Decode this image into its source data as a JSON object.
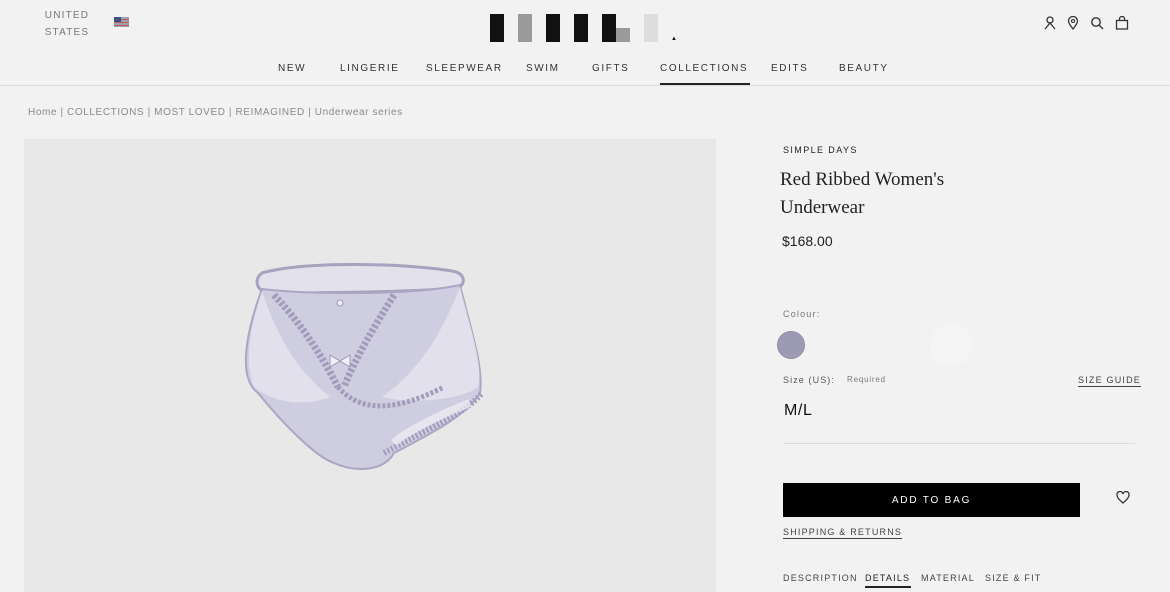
{
  "header": {
    "region": "UNITED STATES",
    "flag_icon": "us-flag-icon",
    "utility_icons": [
      "account-icon",
      "location-pin-icon",
      "search-icon",
      "shopping-bag-icon"
    ]
  },
  "nav": {
    "items": [
      "NEW",
      "LINGERIE",
      "SLEEPWEAR",
      "SWIM",
      "GIFTS",
      "COLLECTIONS",
      "EDITS",
      "BEAUTY"
    ],
    "active": "COLLECTIONS"
  },
  "breadcrumb": "Home | COLLECTIONS | MOST LOVED | REIMAGINED | Underwear series",
  "product": {
    "brand": "SIMPLE DAYS",
    "title": "Red Ribbed Women's Underwear",
    "price": "$168.00",
    "colour_label": "Colour:",
    "swatch_color": "#9d9bb4",
    "size_label": "Size (US):",
    "size_required": "Required",
    "size_guide": "SIZE GUIDE",
    "size_value": "M/L",
    "add_to_bag": "ADD TO BAG",
    "wishlist_icon": "heart-icon",
    "shipping_link": "SHIPPING & RETURNS"
  },
  "tabs": {
    "items": [
      "DESCRIPTION",
      "DETAILS",
      "MATERIAL",
      "SIZE & FIT"
    ],
    "active": "DETAILS"
  },
  "colors": {
    "background": "#f2f2f2",
    "image_background": "#e8e8e8",
    "button": "#000000",
    "text": "#222222"
  }
}
